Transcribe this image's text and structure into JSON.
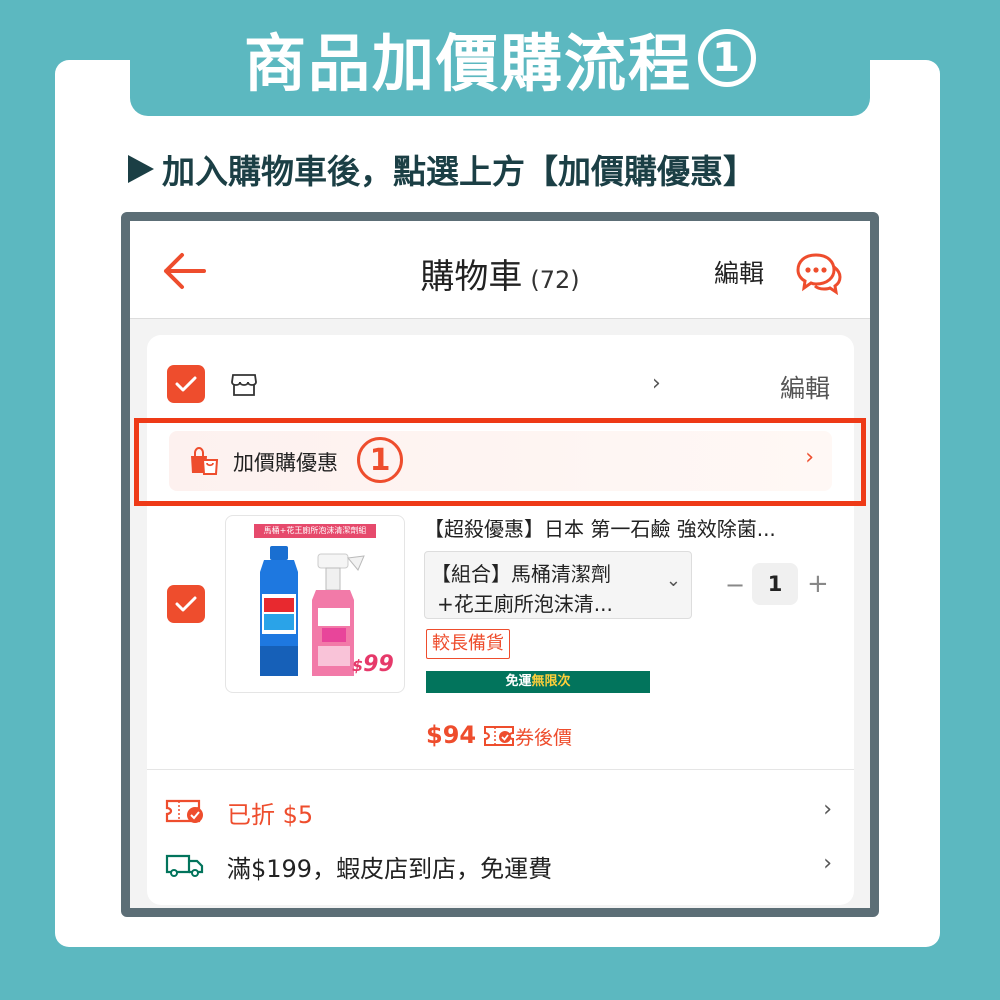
{
  "banner": {
    "title": "商品加價購流程",
    "step_num": "1"
  },
  "instruction": "加入購物車後，點選上方【加價購優惠】",
  "appbar": {
    "title": "購物車",
    "count": "(72)",
    "edit_label": "編輯",
    "back_icon": "arrow-left-icon",
    "chat_icon": "chat-bubbles-icon"
  },
  "shop": {
    "store_icon": "store-icon",
    "chevron": "›",
    "edit_label": "編輯"
  },
  "promo": {
    "label": "加價購優惠",
    "step_num": "1",
    "chevron": "›"
  },
  "item": {
    "thumb_band": "馬桶+花王廁所泡沫清潔劑組",
    "thumb_price_currency": "$",
    "thumb_price": "99",
    "name": "【超殺優惠】日本 第一石鹼 強效除菌...",
    "variant_line1": "【組合】馬桶清潔劑",
    "variant_line2": "+花王廁所泡沫清...",
    "variant_caret": "⌄",
    "qty_minus": "−",
    "qty": "1",
    "qty_plus": "+",
    "tag": "較長備貨",
    "freeship_prefix": "免運",
    "freeship_highlight": "無限次",
    "price": "$94",
    "after_coupon": "券後價"
  },
  "discount_row": {
    "text": "已折 $5",
    "chevron": "›"
  },
  "shipping_row": {
    "text": "滿$199，蝦皮店到店，免運費",
    "chevron": "›"
  },
  "colors": {
    "accent": "#ee4d2d",
    "teal": "#5cb8c0",
    "freeship_green": "#02745c",
    "highlight": "#ee3a17"
  }
}
